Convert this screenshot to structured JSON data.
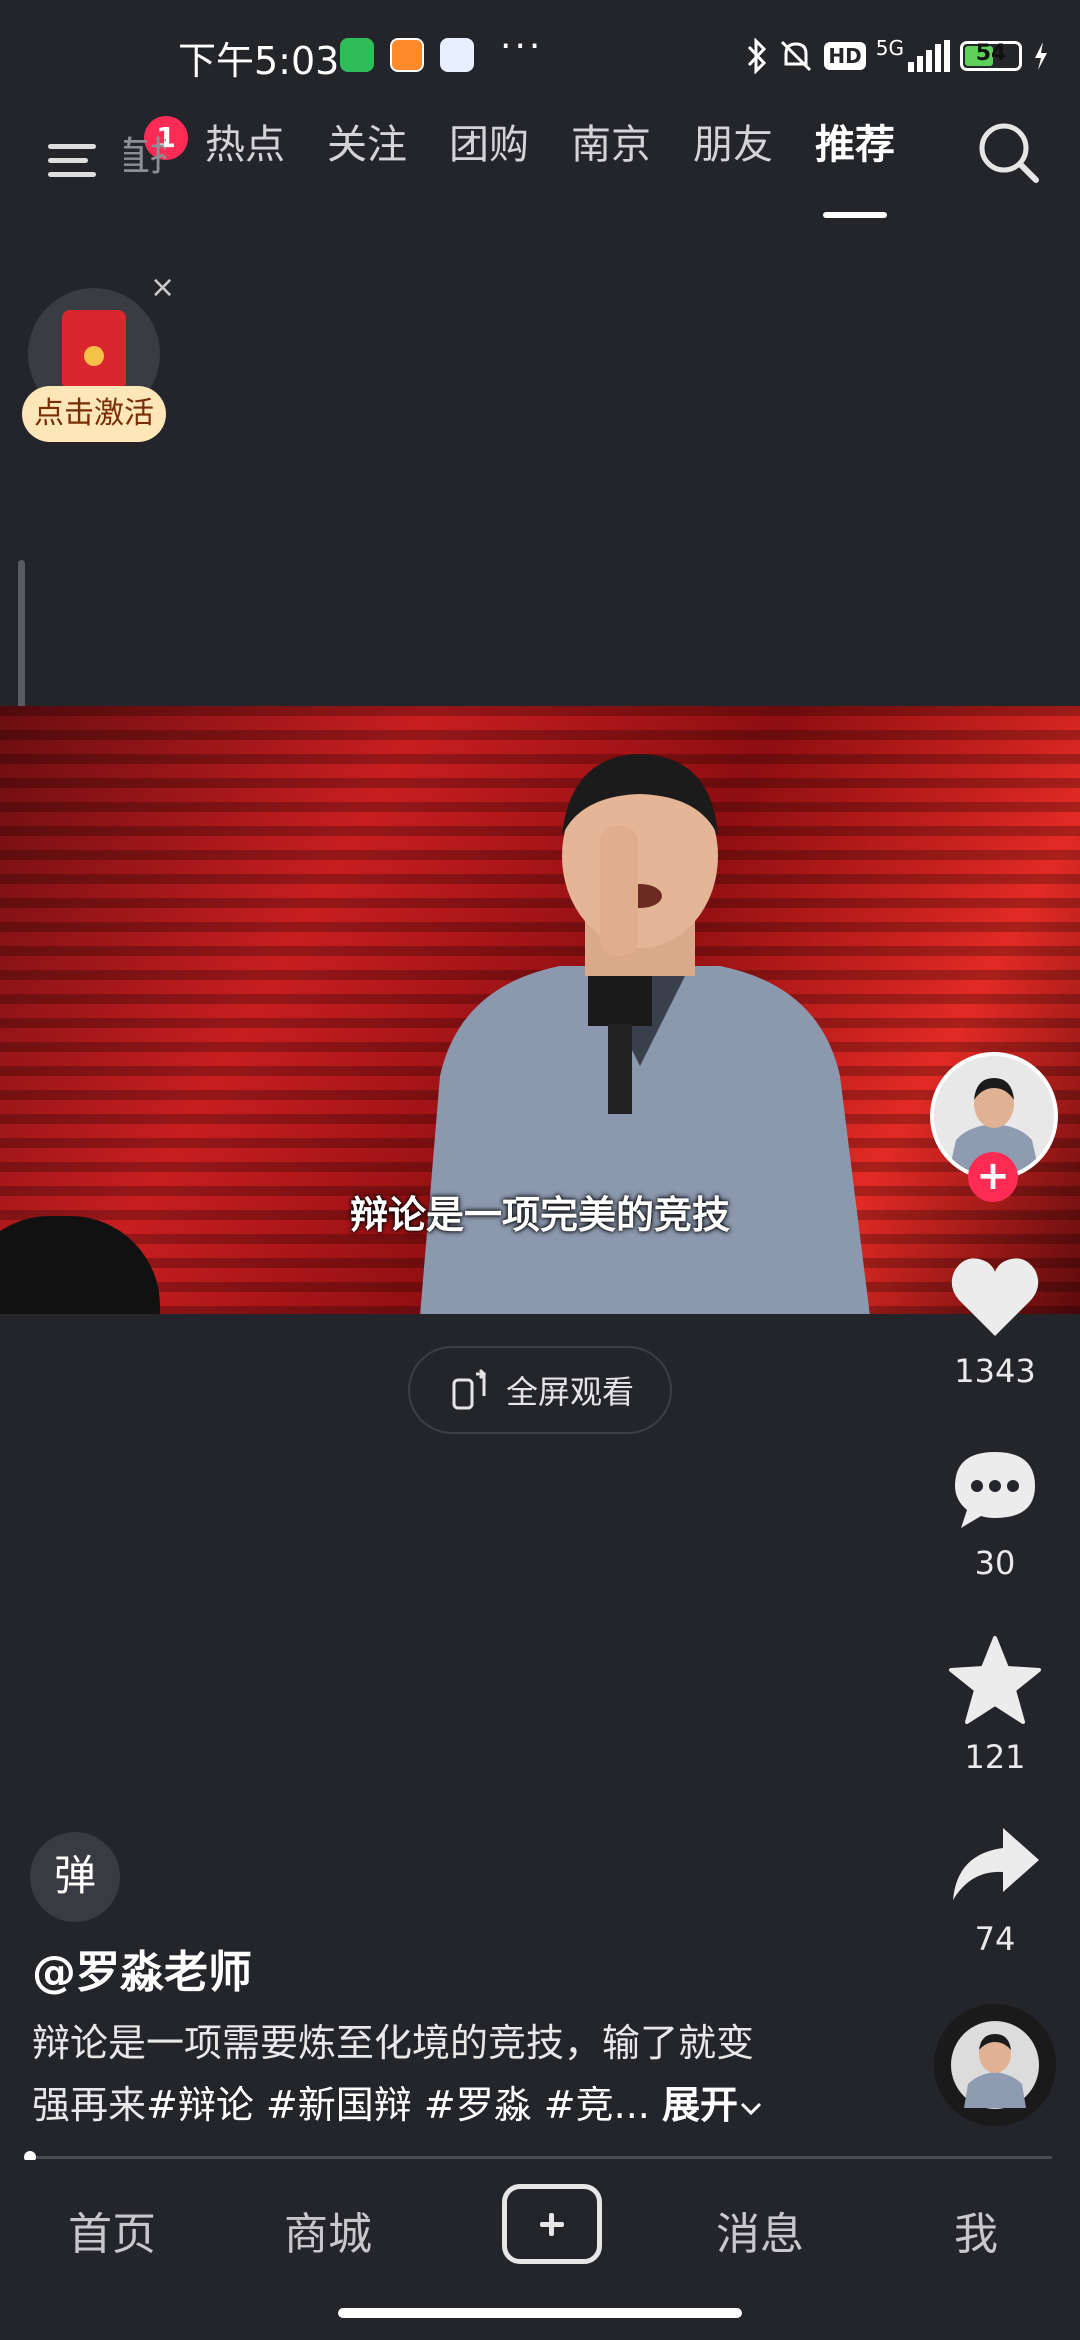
{
  "status_bar": {
    "time": "下午5:03",
    "more": "···",
    "network": "5G",
    "hd": "HD",
    "battery": "54",
    "battery_level": 0.54
  },
  "top_nav": {
    "notification_count": "1",
    "partial_tab": "直播",
    "tabs": [
      "热点",
      "关注",
      "团购",
      "南京",
      "朋友",
      "推荐"
    ],
    "active_tab": "推荐"
  },
  "red_packet": {
    "label": "点击激活",
    "close": "×"
  },
  "video": {
    "subtitle": "辩论是一项完美的竞技",
    "fullscreen_label": "全屏观看"
  },
  "actions": {
    "follow": "+",
    "likes": "1343",
    "comments": "30",
    "favorites": "121",
    "shares": "74"
  },
  "post": {
    "danmaku": "弹",
    "author": "@罗淼老师",
    "caption_line1": "辩论是一项需要炼至化境的竞技，输了就变",
    "caption_line2_prefix": "强再来",
    "tags": "#辩论 #新国辩 #罗淼 #竞...",
    "expand": "展开"
  },
  "bottom_nav": {
    "home": "首页",
    "mall": "商城",
    "messages": "消息",
    "me": "我"
  },
  "colors": {
    "background": "#24252b",
    "accent": "#fe2c55",
    "red_packet_label_bg": "#fde6b8"
  }
}
